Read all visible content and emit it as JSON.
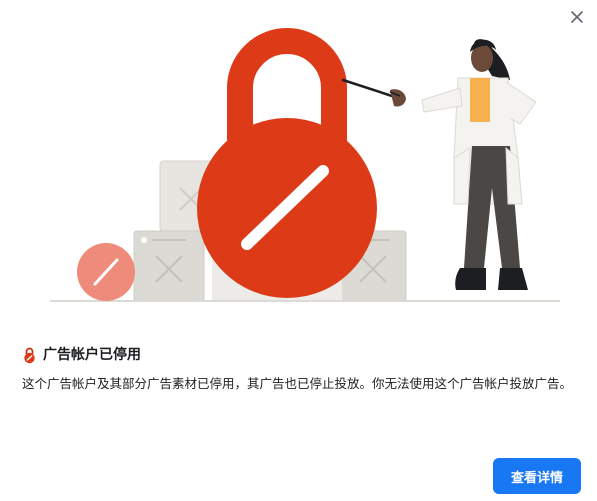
{
  "dialog": {
    "title": "广告帐户已停用",
    "body": "这个广告帐户及其部分广告素材已停用，其广告也已停止投放。你无法使用这个广告帐户投放广告。",
    "details_button_label": "查看详情",
    "close_icon": "close-icon",
    "title_icon": "lock-restricted-icon"
  },
  "colors": {
    "primary_button": "#1877f2",
    "lock_red": "#dd3a17",
    "small_lock_coral": "#ef8b7a",
    "shirt_yellow": "#f7b24f"
  }
}
